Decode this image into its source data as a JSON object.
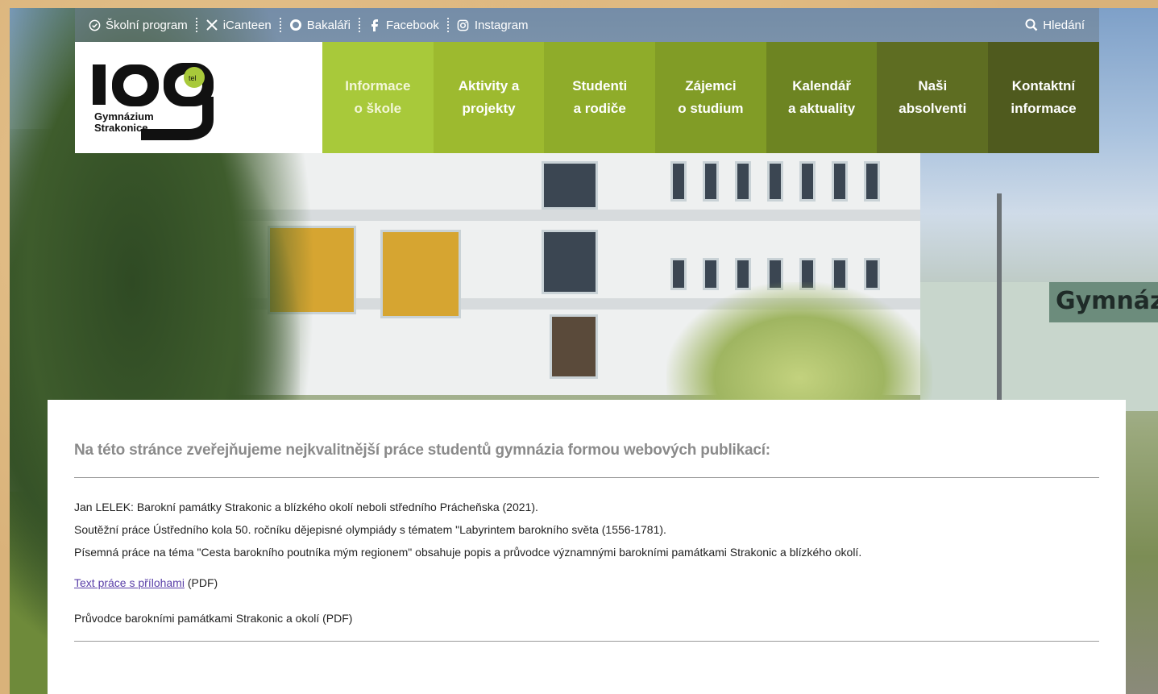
{
  "topbar": {
    "items": [
      {
        "label": "Školní program",
        "icon": "clock-check-icon"
      },
      {
        "label": "iCanteen",
        "icon": "cutlery-icon"
      },
      {
        "label": "Bakaláři",
        "icon": "bakalari-icon"
      },
      {
        "label": "Facebook",
        "icon": "facebook-icon"
      },
      {
        "label": "Instagram",
        "icon": "instagram-icon"
      }
    ],
    "search_label": "Hledání",
    "search_icon": "search-icon"
  },
  "logo": {
    "text_line1": "Gymnázium",
    "text_line2": "Strakonice",
    "mark": "iog",
    "badge": "tel"
  },
  "hero": {
    "sign_text": "Gymnáz"
  },
  "nav": {
    "items": [
      {
        "line1": "Informace",
        "line2": "o škole",
        "color": "#a8c93a"
      },
      {
        "line1": "Aktivity a",
        "line2": "projekty",
        "color": "#9dba2f"
      },
      {
        "line1": "Studenti",
        "line2": "a rodiče",
        "color": "#8fac2a"
      },
      {
        "line1": "Zájemci",
        "line2": "o studium",
        "color": "#819c26"
      },
      {
        "line1": "Kalendář",
        "line2": "a aktuality",
        "color": "#6d8422"
      },
      {
        "line1": "Naši",
        "line2": "absolventi",
        "color": "#5e6d22"
      },
      {
        "line1": "Kontaktní",
        "line2": "informace",
        "color": "#4f5a1e"
      }
    ]
  },
  "content": {
    "heading": "Na této stránce zveřejňujeme nejkvalitnější práce studentů gymnázia formou webových publikací:",
    "lines": [
      "Jan LELEK: Barokní památky Strakonic a blízkého okolí neboli středního Prácheňska (2021).",
      "Soutěžní práce Ústředního kola 50. ročníku dějepisné olympiády s tématem \"Labyrintem barokního světa (1556-1781).",
      "Písemná práce na téma \"Cesta barokního poutníka mým regionem\" obsahuje popis a průvodce významnými barokními památkami Strakonic a blízkého okolí."
    ],
    "link1_text": "Text práce s přílohami",
    "link1_suffix": " (PDF)",
    "line2_text": "Průvodce barokními památkami Strakonic a okolí (PDF)"
  }
}
